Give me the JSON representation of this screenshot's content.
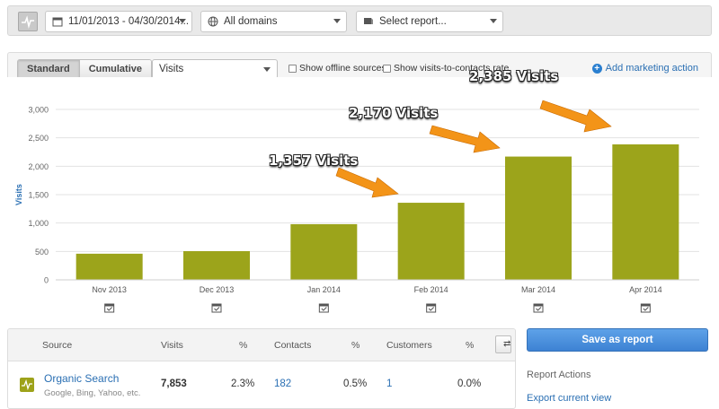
{
  "toolbar": {
    "date_range": "11/01/2013 - 04/30/2014...",
    "domains": "All domains",
    "report": "Select report..."
  },
  "controls": {
    "standard_label": "Standard",
    "cumulative_label": "Cumulative",
    "metric": "Visits",
    "offline_label": "Show offline sources",
    "contacts_rate_label": "Show visits-to-contacts rate",
    "add_action_label": "Add marketing action"
  },
  "colors": {
    "bar": "#9ca41b",
    "accent": "#2a6fb3",
    "arrow": "#f39418"
  },
  "chart_data": {
    "type": "bar",
    "categories": [
      "Nov 2013",
      "Dec 2013",
      "Jan 2014",
      "Feb 2014",
      "Mar 2014",
      "Apr 2014"
    ],
    "values": [
      460,
      505,
      980,
      1357,
      2170,
      2385
    ],
    "ylabel": "Visits",
    "ylim": [
      0,
      3000
    ],
    "yticks": [
      "0",
      "500",
      "1,000",
      "1,500",
      "2,000",
      "2,500",
      "3,000"
    ],
    "grid": true
  },
  "callouts": [
    "1,357 Visits",
    "2,170 Visits",
    "2,385 Visits"
  ],
  "table": {
    "headers": [
      "Source",
      "Visits",
      "%",
      "Contacts",
      "%",
      "Customers",
      "%"
    ],
    "row": {
      "source": "Organic Search",
      "sub": "Google, Bing, Yahoo, etc.",
      "visits": "7,853",
      "visits_pct": "2.3%",
      "contacts": "182",
      "contacts_pct": "0.5%",
      "customers": "1",
      "customers_pct": "0.0%"
    }
  },
  "side": {
    "save_label": "Save as report",
    "actions_title": "Report Actions",
    "export_label": "Export current view"
  }
}
